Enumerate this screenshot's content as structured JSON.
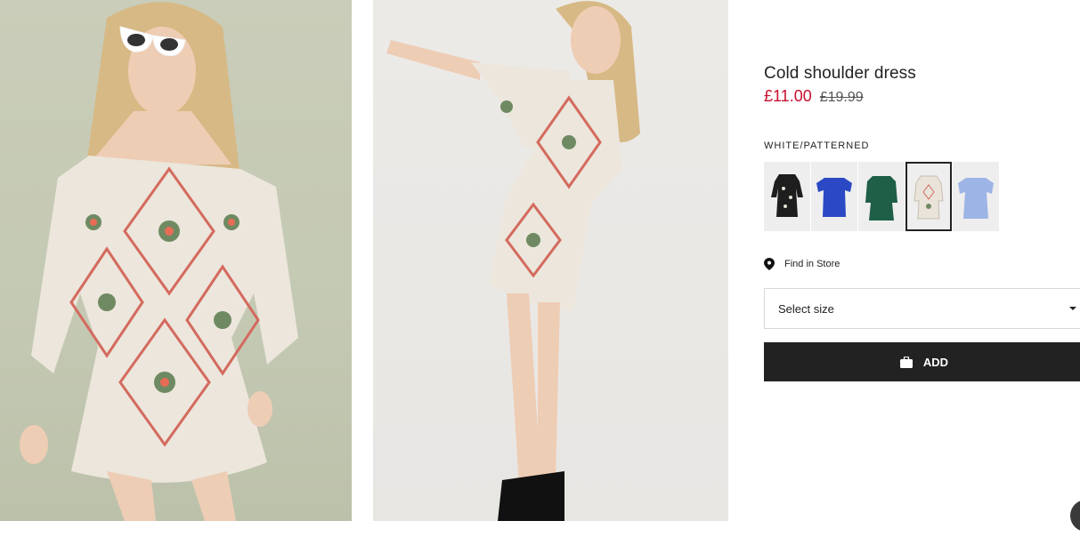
{
  "product": {
    "title": "Cold shoulder dress",
    "price_sale": "£11.00",
    "price_original": "£19.99",
    "color_label": "WHITE/PATTERNED"
  },
  "swatches": [
    {
      "name": "black floral",
      "color": "#1e1e1e",
      "selected": false
    },
    {
      "name": "blue",
      "color": "#2b49c4",
      "selected": false
    },
    {
      "name": "green",
      "color": "#1f5e47",
      "selected": false
    },
    {
      "name": "white patterned",
      "color": "#e9e3da",
      "selected": true
    },
    {
      "name": "light blue",
      "color": "#9db4e6",
      "selected": false
    }
  ],
  "store": {
    "label": "Find in Store",
    "icon": "location-pin-icon"
  },
  "size_select": {
    "label": "Select size",
    "icon": "caret-down-icon"
  },
  "add_button": {
    "label": "ADD",
    "icon": "shopping-bag-icon"
  },
  "colors": {
    "sale": "#c8102e",
    "button": "#222222"
  }
}
